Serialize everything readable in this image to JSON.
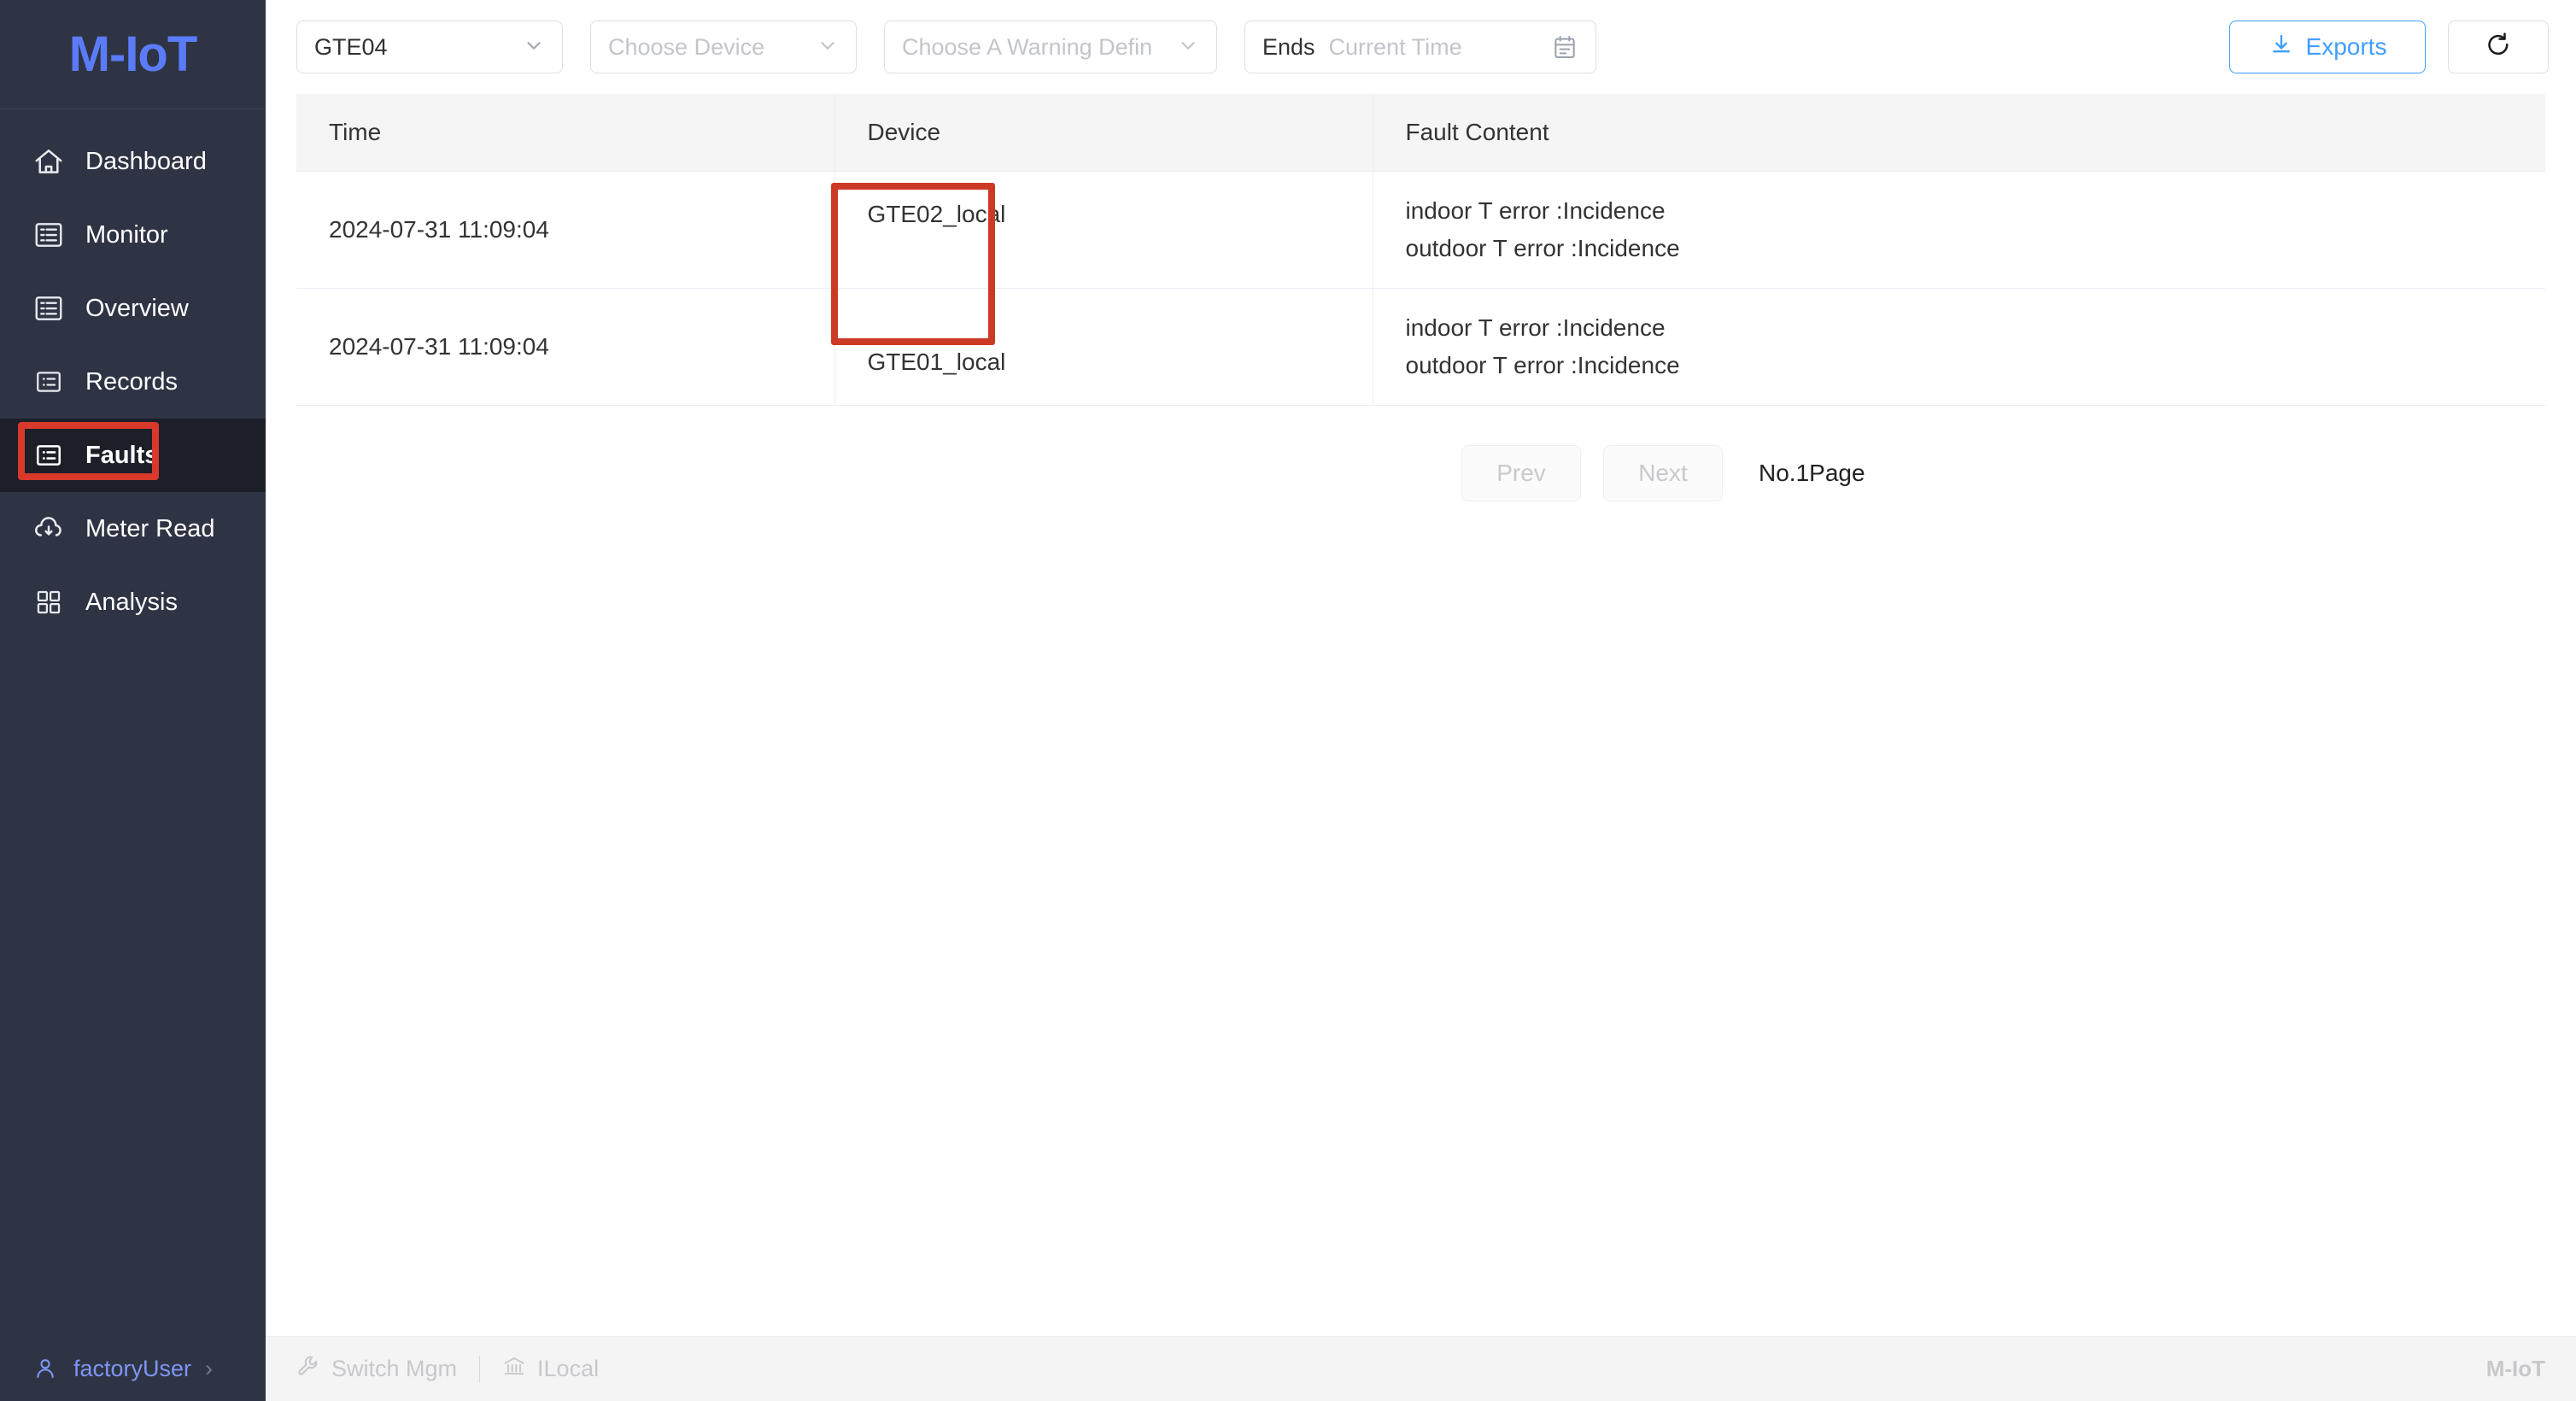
{
  "brand": {
    "name": "M-IoT"
  },
  "sidebar": {
    "items": [
      {
        "label": "Dashboard",
        "icon": "home-icon",
        "active": false
      },
      {
        "label": "Monitor",
        "icon": "list-icon",
        "active": false
      },
      {
        "label": "Overview",
        "icon": "list-icon",
        "active": false
      },
      {
        "label": "Records",
        "icon": "list-box-icon",
        "active": false
      },
      {
        "label": "Faults",
        "icon": "list-box-icon",
        "active": true
      },
      {
        "label": "Meter Read",
        "icon": "cloud-down-icon",
        "active": false
      },
      {
        "label": "Analysis",
        "icon": "grid-icon",
        "active": false
      }
    ],
    "footer": {
      "user": "factoryUser",
      "icon": "user-icon",
      "chevron": "chevron-right-icon"
    }
  },
  "toolbar": {
    "site_select": {
      "value": "GTE04",
      "icon": "chevron-down-icon"
    },
    "device_select": {
      "placeholder": "Choose Device",
      "value": "",
      "icon": "chevron-down-icon"
    },
    "warning_select": {
      "placeholder": "Choose A Warning Defin",
      "value": "",
      "icon": "chevron-down-icon"
    },
    "end_date": {
      "label": "Ends",
      "placeholder": "Current Time",
      "value": "",
      "icon": "calendar-icon"
    },
    "export_button": {
      "label": "Exports",
      "icon": "download-icon"
    },
    "refresh_button": {
      "label": "",
      "icon": "refresh-icon"
    }
  },
  "table": {
    "columns": [
      "Time",
      "Device",
      "Fault Content"
    ],
    "rows": [
      {
        "time": "2024-07-31 11:09:04",
        "device": "GTE02_local",
        "fault_lines": [
          "indoor T error :Incidence",
          "outdoor T error :Incidence"
        ]
      },
      {
        "time": "2024-07-31 11:09:04",
        "device": "GTE01_local",
        "fault_lines": [
          "indoor T error :Incidence",
          "outdoor T error :Incidence"
        ]
      }
    ]
  },
  "pagination": {
    "prev_label": "Prev",
    "next_label": "Next",
    "page_info": "No.1Page"
  },
  "statusbar": {
    "switch_mgm": {
      "label": "Switch Mgm",
      "icon": "wrench-icon"
    },
    "locale": {
      "label": "ILocal",
      "icon": "bank-icon"
    },
    "brand": "M-IoT"
  },
  "annotations": {
    "faults_highlight_color": "#d8392b",
    "device_highlight_color": "#cc3a26"
  },
  "colors": {
    "sidebar_bg": "#2f3444",
    "sidebar_active_bg": "#1d1f28",
    "brand_blue": "#5b7cfa",
    "accent_blue": "#409eff",
    "table_header_bg": "#f5f5f5"
  }
}
